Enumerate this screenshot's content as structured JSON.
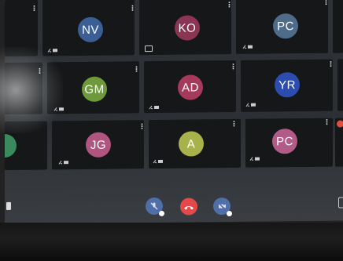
{
  "participants": [
    {
      "initials": "NV",
      "color": "#3b5e95"
    },
    {
      "initials": "KO",
      "color": "#8a3552"
    },
    {
      "initials": "PC",
      "color": "#4f6b8a"
    },
    {
      "initials": "GM",
      "color": "#6f9a3c"
    },
    {
      "initials": "AD",
      "color": "#a63a5c"
    },
    {
      "initials": "YR",
      "color": "#2c4cb0"
    },
    {
      "initials": "JG",
      "color": "#b05580"
    },
    {
      "initials": "A",
      "color": "#a8b24a"
    },
    {
      "initials": "PC",
      "color": "#b25a88"
    }
  ],
  "tile_menu_glyph": "⋮",
  "controls": {
    "mute_color": "#4e6fa8",
    "hangup_color": "#e44848",
    "share_color": "#4e6fa8"
  }
}
